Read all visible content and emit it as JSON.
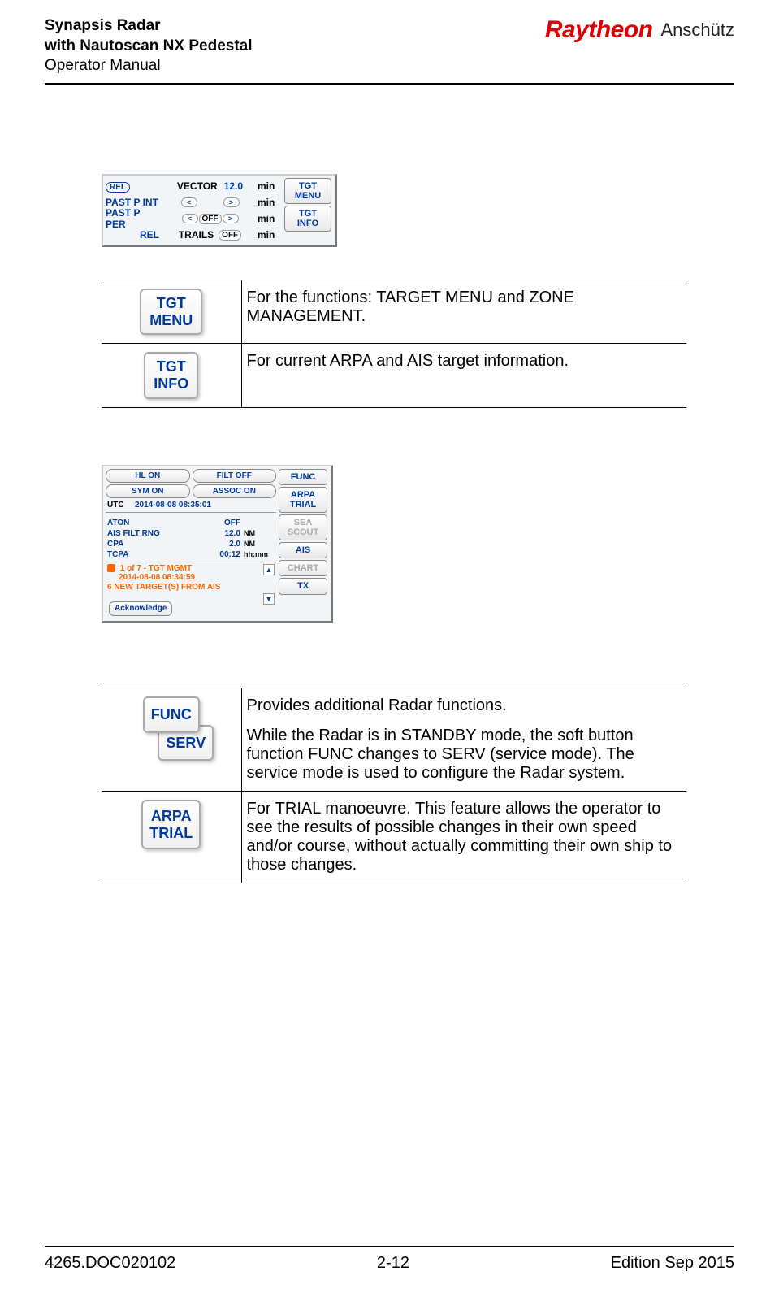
{
  "header": {
    "title1": "Synapsis Radar",
    "title2": "with Nautoscan NX Pedestal",
    "subtitle": "Operator Manual",
    "brand1": "Raytheon",
    "brand2": "Anschütz"
  },
  "panel1": {
    "rows": [
      {
        "label": "",
        "rel": "REL",
        "mid_text": "VECTOR",
        "value": "12.0",
        "unit": "min"
      },
      {
        "label": "PAST P INT",
        "left_arrow": "<",
        "right_arrow": ">",
        "unit": "min"
      },
      {
        "label": "PAST P PER",
        "left_arrow": "<",
        "off": "OFF",
        "right_arrow": ">",
        "unit": "min"
      },
      {
        "label": "REL",
        "mid_text": "TRAILS",
        "off": "OFF",
        "unit": "min"
      }
    ],
    "side": [
      {
        "l1": "TGT",
        "l2": "MENU"
      },
      {
        "l1": "TGT",
        "l2": "INFO"
      }
    ]
  },
  "table1": [
    {
      "btn_l1": "TGT",
      "btn_l2": "MENU",
      "desc": "For the functions: TARGET MENU and ZONE MANAGEMENT."
    },
    {
      "btn_l1": "TGT",
      "btn_l2": "INFO",
      "desc": "For current ARPA and AIS target information."
    }
  ],
  "panel2": {
    "top_buttons": [
      [
        "HL ON",
        "FILT OFF"
      ],
      [
        "SYM ON",
        "ASSOC ON"
      ]
    ],
    "utc_label": "UTC",
    "utc_value": "2014-08-08  08:35:01",
    "status": [
      {
        "k": "ATON",
        "v": "OFF",
        "u": ""
      },
      {
        "k": "AIS FILT RNG",
        "v": "12.0",
        "u": "NM"
      },
      {
        "k": "CPA",
        "v": "2.0",
        "u": "NM"
      },
      {
        "k": "TCPA",
        "v": "00:12",
        "u": "hh:mm"
      }
    ],
    "alarm": {
      "line1": "1 of 7 - TGT MGMT",
      "line2": "2014-08-08 08:34:59",
      "line3": "6 NEW TARGET(S) FROM AIS",
      "ack": "Acknowledge"
    },
    "side": [
      {
        "t": "FUNC",
        "disabled": false
      },
      {
        "t": "ARPA\nTRIAL",
        "disabled": false
      },
      {
        "t": "SEA\nSCOUT",
        "disabled": true
      },
      {
        "t": "AIS",
        "disabled": false
      },
      {
        "t": "CHART",
        "disabled": true
      },
      {
        "t": "TX",
        "disabled": false
      }
    ]
  },
  "table2": [
    {
      "btns": [
        "FUNC",
        "SERV"
      ],
      "desc1": "Provides additional Radar functions.",
      "desc2": "While the Radar is in STANDBY mode, the soft button function FUNC changes to SERV (service mode). The service mode is used to configure the Radar system."
    },
    {
      "btns": [
        "ARPA",
        "TRIAL"
      ],
      "desc1": "For TRIAL manoeuvre. This feature allows the operator to see the results of possible changes in their own speed and/or course, without actually committing their own ship to those changes."
    }
  ],
  "footer": {
    "left": "4265.DOC020102",
    "center": "2-12",
    "right": "Edition Sep 2015"
  }
}
